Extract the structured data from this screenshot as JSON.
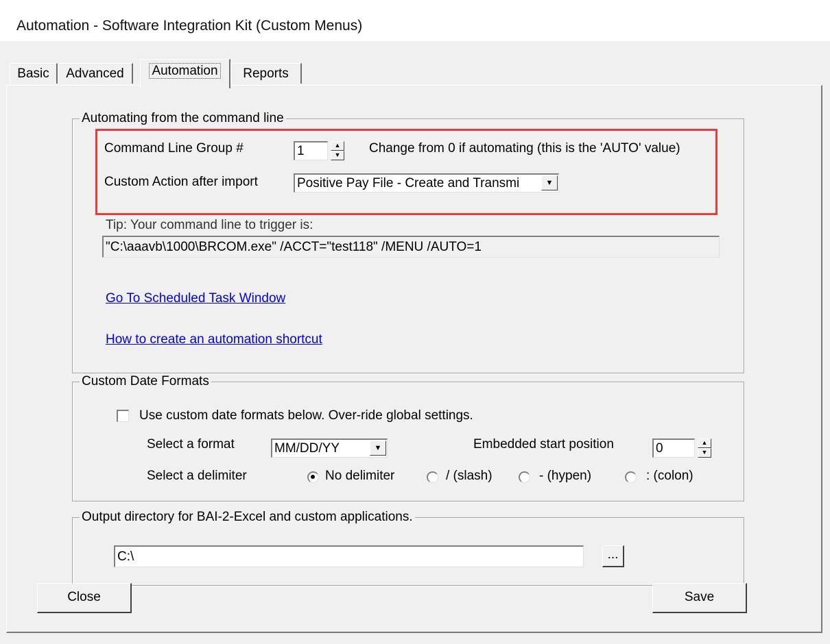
{
  "window": {
    "title": "Automation - Software Integration Kit (Custom Menus)"
  },
  "tabs": [
    {
      "label": "Basic",
      "active": false
    },
    {
      "label": "Advanced",
      "active": false
    },
    {
      "label": "Automation",
      "active": true
    },
    {
      "label": "Reports",
      "active": false
    }
  ],
  "command_line": {
    "group_title": "Automating from the command line",
    "group_number_label": "Command Line Group #",
    "group_number_value": "1",
    "group_number_hint": "Change from 0 if automating (this is the 'AUTO' value)",
    "custom_action_label": "Custom Action after import",
    "custom_action_value": "Positive Pay File - Create and Transmi",
    "tip_label": "Tip: Your command line to trigger is:",
    "command_text": "\"C:\\aaavb\\1000\\BRCOM.exe\" /ACCT=\"test118\" /MENU /AUTO=1",
    "link_scheduled_task": "Go To Scheduled Task Window",
    "link_shortcut": "How to create an automation shortcut",
    "highlight_color": "#e04040"
  },
  "date_formats": {
    "group_title": "Custom Date Formats",
    "use_custom_label": "Use custom date formats below.  Over-ride global settings.",
    "use_custom_checked": false,
    "select_format_label": "Select a format",
    "format_value": "MM/DD/YY",
    "embedded_start_label": "Embedded start position",
    "embedded_start_value": "0",
    "delimiter_label": "Select a delimiter",
    "delimiters": [
      {
        "label": "No delimiter",
        "checked": true
      },
      {
        "label": "/ (slash)",
        "checked": false
      },
      {
        "label": "- (hypen)",
        "checked": false
      },
      {
        "label": ": (colon)",
        "checked": false
      }
    ]
  },
  "output": {
    "group_title": "Output directory for BAI-2-Excel and custom applications.",
    "directory_value": "C:\\",
    "browse_label": "..."
  },
  "buttons": {
    "close_label": "Close",
    "save_label": "Save"
  }
}
